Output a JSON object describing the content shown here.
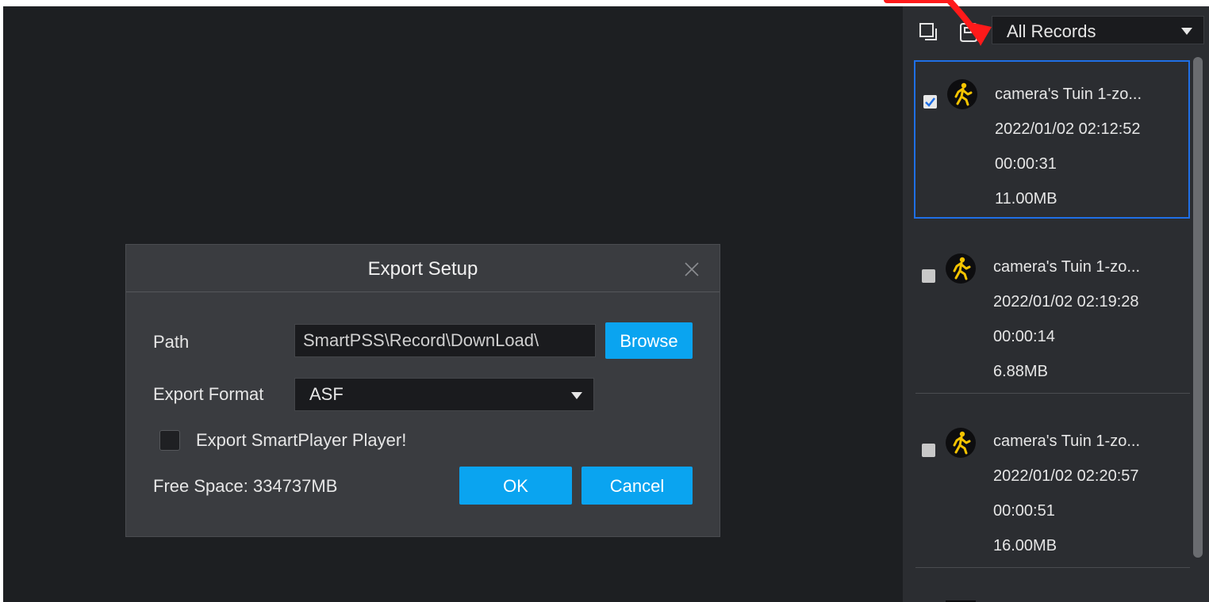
{
  "toolbar": {
    "filter_value": "All Records",
    "icons": [
      "copy-records-icon",
      "export-record-icon"
    ]
  },
  "records": [
    {
      "name": "camera's Tuin 1-zo...",
      "datetime": "2022/01/02 02:12:52",
      "duration": "00:00:31",
      "size": "11.00MB",
      "checked": true
    },
    {
      "name": "camera's Tuin 1-zo...",
      "datetime": "2022/01/02 02:19:28",
      "duration": "00:00:14",
      "size": "6.88MB",
      "checked": false
    },
    {
      "name": "camera's Tuin 1-zo...",
      "datetime": "2022/01/02 02:20:57",
      "duration": "00:00:51",
      "size": "16.00MB",
      "checked": false
    }
  ],
  "dialog": {
    "title": "Export Setup",
    "path_label": "Path",
    "path_value": "SmartPSS\\Record\\DownLoad\\",
    "browse_label": "Browse",
    "format_label": "Export Format",
    "format_value": "ASF",
    "player_checkbox_label": "Export SmartPlayer Player!",
    "free_space": "Free Space: 334737MB",
    "ok_label": "OK",
    "cancel_label": "Cancel"
  },
  "colors": {
    "accent": "#0aa4f0",
    "selection_border": "#1f6fe6",
    "event_icon": "#f5c400",
    "annotation": "#ff1a1a"
  }
}
